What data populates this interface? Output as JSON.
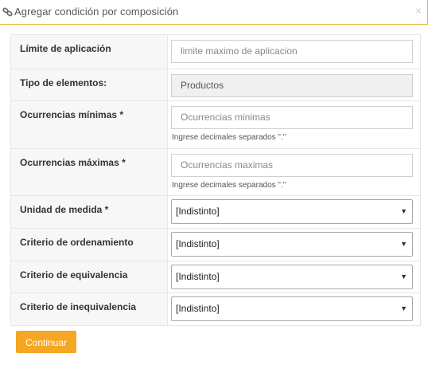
{
  "dialog": {
    "title": "Agregar condición por composición",
    "close": "×"
  },
  "fields": [
    {
      "label": "Límite de aplicación",
      "type": "input",
      "placeholder": "limite maximo de aplicacion",
      "value": ""
    },
    {
      "label": "Tipo de elementos:",
      "type": "readonly",
      "value": "Productos"
    },
    {
      "label": "Ocurrencias mínimas *",
      "type": "input",
      "placeholder": "Ocurrencias minimas",
      "value": "",
      "hint": "Ingrese decimales separados \".\""
    },
    {
      "label": "Ocurrencias máximas *",
      "type": "input",
      "placeholder": "Ocurrencias maximas",
      "value": "",
      "hint": "Ingrese decimales separados \".\""
    },
    {
      "label": "Unidad de medida *",
      "type": "select",
      "value": "[Indistinto]"
    },
    {
      "label": "Criterio de ordenamiento",
      "type": "select",
      "value": "[Indistinto]"
    },
    {
      "label": "Criterio de equivalencia",
      "type": "select",
      "value": "[Indistinto]"
    },
    {
      "label": "Criterio de inequivalencia",
      "type": "select",
      "value": "[Indistinto]"
    }
  ],
  "actions": {
    "continue_label": "Continuar"
  },
  "colors": {
    "accent": "#f5a623",
    "title_border": "#e9b82c"
  },
  "icons": {
    "title": "link-icon",
    "select_arrow": "chevron-down-icon"
  }
}
